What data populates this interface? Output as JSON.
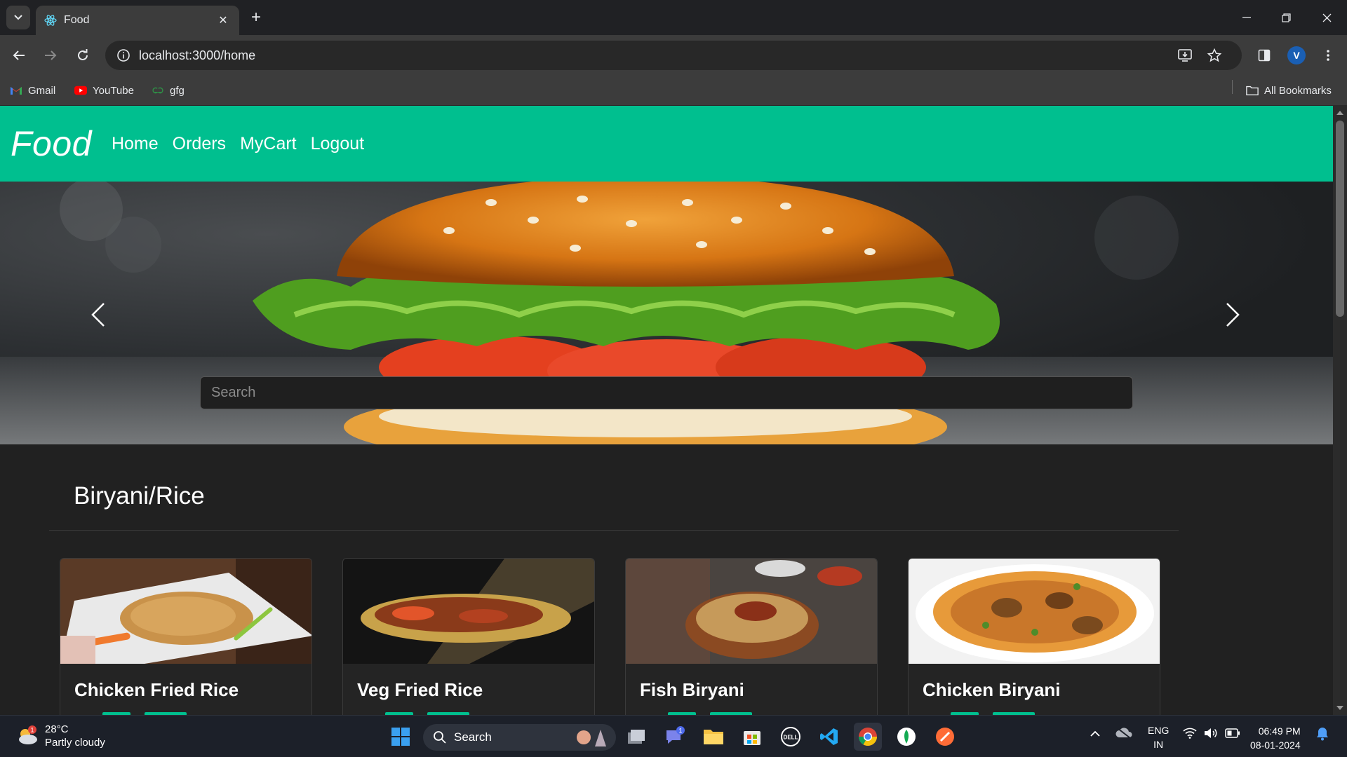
{
  "browser": {
    "tab_title": "Food",
    "url": "localhost:3000/home",
    "profile_initial": "V",
    "bookmarks": [
      {
        "label": "Gmail",
        "icon": "gmail-icon"
      },
      {
        "label": "YouTube",
        "icon": "youtube-icon"
      },
      {
        "label": "gfg",
        "icon": "gfg-icon"
      }
    ],
    "all_bookmarks_label": "All Bookmarks"
  },
  "page": {
    "brand": "Food",
    "nav": [
      {
        "label": "Home"
      },
      {
        "label": "Orders"
      },
      {
        "label": "MyCart"
      },
      {
        "label": "Logout"
      }
    ],
    "search_placeholder": "Search",
    "section_title": "Biryani/Rice",
    "cards": [
      {
        "title": "Chicken Fried Rice"
      },
      {
        "title": "Veg Fried Rice"
      },
      {
        "title": "Fish Biryani"
      },
      {
        "title": "Chicken Biryani"
      }
    ],
    "colors": {
      "accent": "#00bf8f",
      "background": "#212121"
    }
  },
  "taskbar": {
    "weather_temp": "28°C",
    "weather_desc": "Partly cloudy",
    "weather_badge": "1",
    "search_label": "Search",
    "teams_badge": "1",
    "lang_1": "ENG",
    "lang_2": "IN",
    "time": "06:49 PM",
    "date": "08-01-2024"
  }
}
